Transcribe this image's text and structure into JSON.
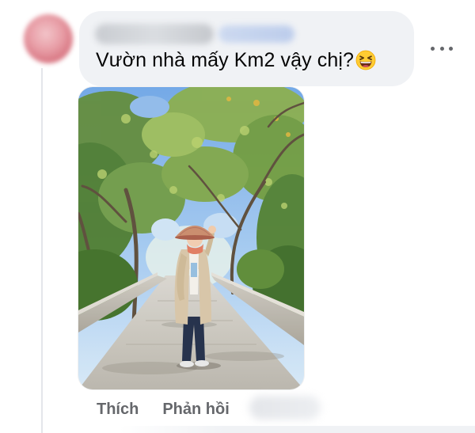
{
  "comment": {
    "text": "Vườn nhà mấy Km2 vậy chị?",
    "emoji": "grinning-squinting-face-icon"
  },
  "actions": {
    "like_label": "Thích",
    "reply_label": "Phản hồi"
  },
  "colors": {
    "bubble": "#f0f2f5",
    "text": "#050505",
    "secondary_text": "#65676b"
  }
}
